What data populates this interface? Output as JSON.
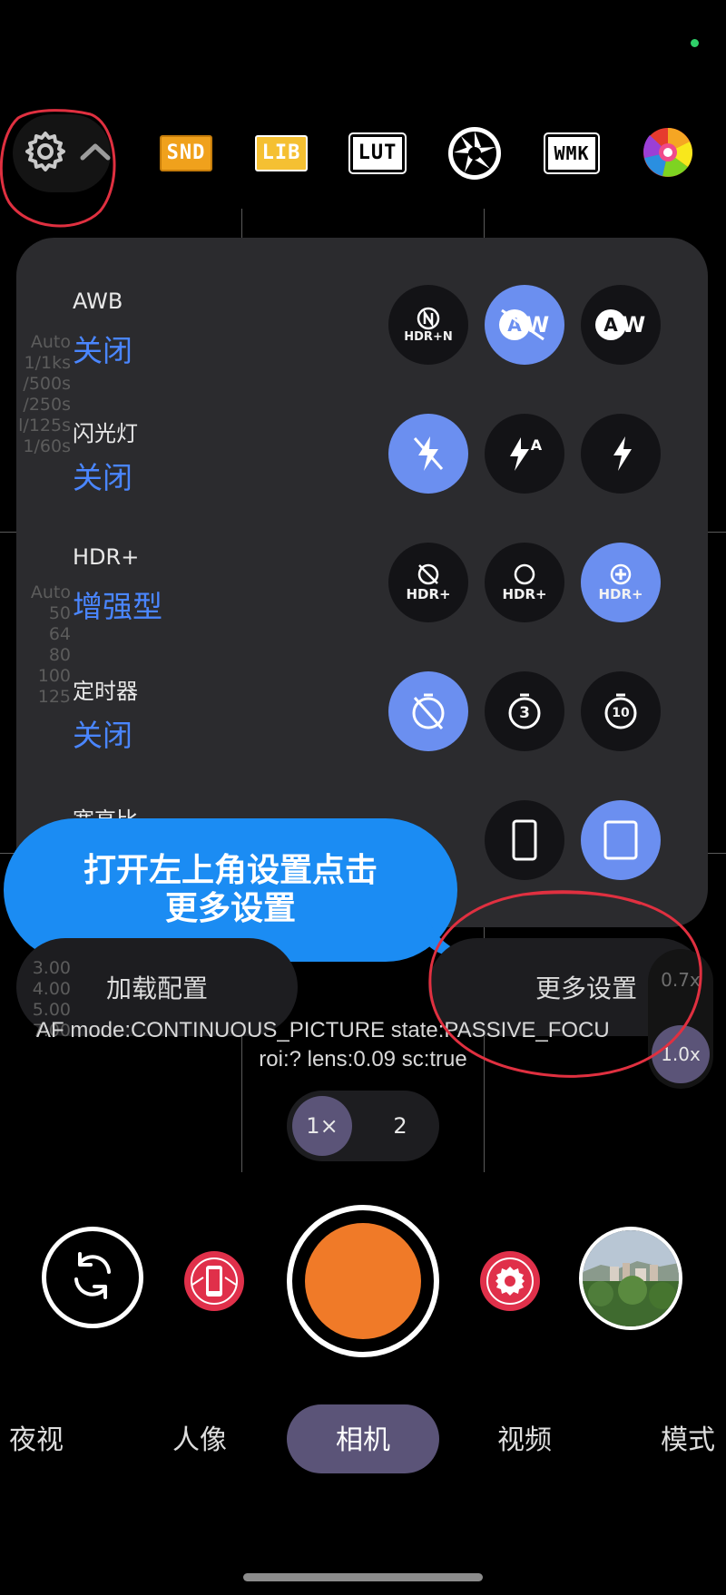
{
  "toolbar": {
    "badges": [
      {
        "label": "SND",
        "bg": "#f0a11c",
        "fg": "#ffffff"
      },
      {
        "label": "LIB",
        "bg": "#f5c032",
        "fg": "#ffffff"
      },
      {
        "label": "LUT",
        "bg": "#ffffff",
        "fg": "#000000"
      },
      {
        "label": "WMK",
        "bg": "#ffffff",
        "fg": "#000000"
      }
    ]
  },
  "settings": {
    "awb": {
      "title": "AWB",
      "value": "关闭"
    },
    "flash": {
      "title": "闪光灯",
      "value": "关闭"
    },
    "hdr": {
      "title": "HDR+",
      "value": "增强型"
    },
    "timer": {
      "title": "定时器",
      "value": "关闭"
    },
    "aspect": {
      "title": "宽高比"
    },
    "hdr_labels": {
      "n": "HDR+N",
      "plus": "HDR+"
    },
    "timer_labels": {
      "three": "3",
      "ten": "10"
    }
  },
  "ghost_overlay": {
    "shutter_values": [
      "Auto",
      "1/1ks",
      "/500s",
      "/250s",
      "l/125s",
      "1/60s"
    ],
    "iso_values": [
      "Auto",
      "50",
      "64",
      "80",
      "100",
      "125"
    ],
    "focus_values": [
      "3.00",
      "4.00",
      "5.00",
      "7.00"
    ]
  },
  "bubble": {
    "line1": "打开左上角设置点击",
    "line2": "更多设置"
  },
  "buttons": {
    "load_config": "加载配置",
    "more_settings": "更多设置"
  },
  "zoom_side": {
    "z1": "0.7x",
    "z2": "1.0x"
  },
  "debug": {
    "line1": "AF mode:CONTINUOUS_PICTURE state:PASSIVE_FOCU",
    "line2": "roi:? lens:0.09 sc:true"
  },
  "zoom": {
    "a": "1×",
    "b": "2"
  },
  "modes": [
    "夜视",
    "人像",
    "相机",
    "视频",
    "模式"
  ],
  "colors": {
    "accent": "#4a86ff",
    "shutter": "#f07a28",
    "mode_active_bg": "#5b5478",
    "bubble": "#1b8cf3",
    "annotation": "#e03040"
  }
}
